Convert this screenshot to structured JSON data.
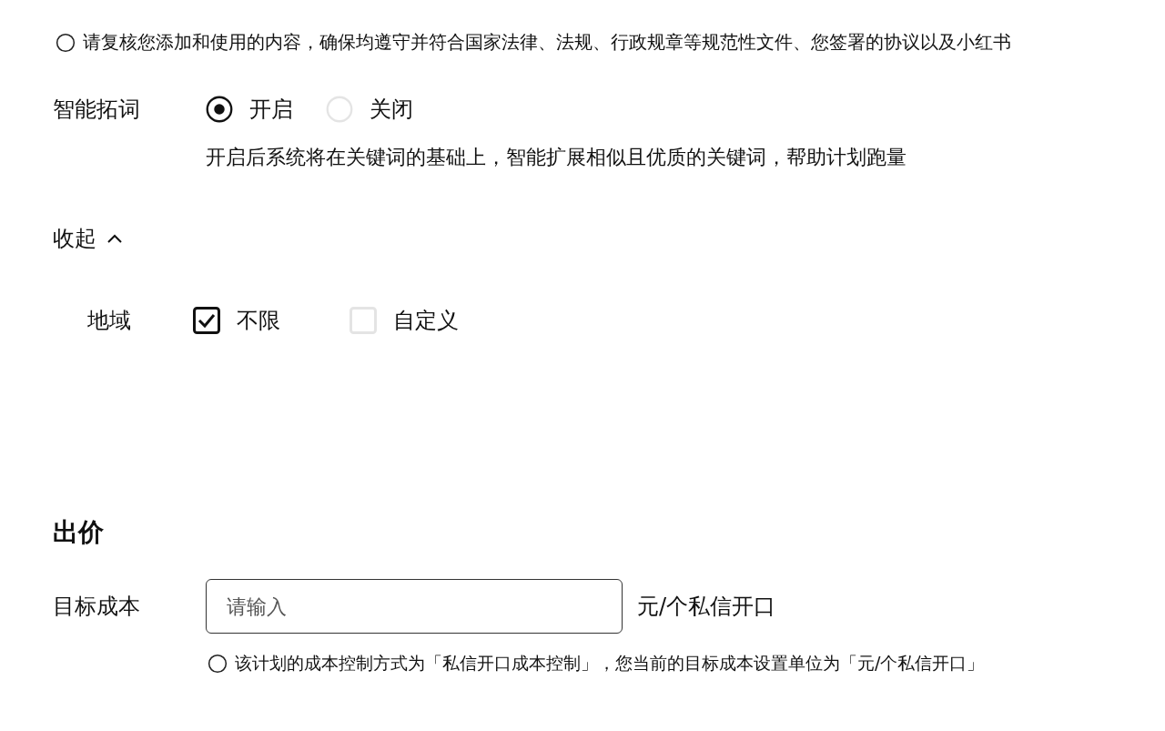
{
  "top_notice": {
    "text": "请复核您添加和使用的内容，确保均遵守并符合国家法律、法规、行政规章等规范性文件、您签署的协议以及小红书"
  },
  "smart_keywords": {
    "label": "智能拓词",
    "options": [
      {
        "label": "开启",
        "selected": true
      },
      {
        "label": "关闭",
        "selected": false
      }
    ],
    "description": "开启后系统将在关键词的基础上，智能扩展相似且优质的关键词，帮助计划跑量"
  },
  "collapse": {
    "label": "收起",
    "expanded": true
  },
  "region": {
    "label": "地域",
    "options": [
      {
        "label": "不限",
        "checked": true
      },
      {
        "label": "自定义",
        "checked": false
      }
    ]
  },
  "bid": {
    "title": "出价",
    "field_label": "目标成本",
    "placeholder": "请输入",
    "unit": "元/个私信开口",
    "notice": "该计划的成本控制方式为「私信开口成本控制」，您当前的目标成本设置单位为「元/个私信开口」"
  }
}
